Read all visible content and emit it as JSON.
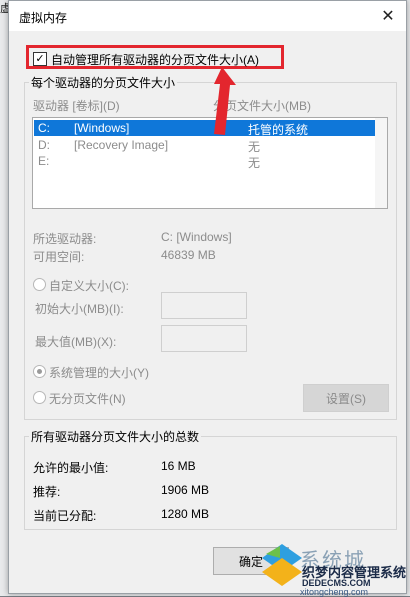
{
  "window": {
    "title": "虚拟内存",
    "close_glyph": "✕",
    "behind_char": "虚"
  },
  "auto_manage": {
    "label": "自动管理所有驱动器的分页文件大小(A)",
    "checked": true,
    "check_glyph": "✓"
  },
  "per_drive": {
    "group_title": "每个驱动器的分页文件大小",
    "col_drive": "驱动器 [卷标](D)",
    "col_size": "分页文件大小(MB)",
    "rows": [
      {
        "drive": "C:",
        "label": "[Windows]",
        "size": "托管的系统",
        "selected": true
      },
      {
        "drive": "D:",
        "label": "[Recovery Image]",
        "size": "无",
        "selected": false
      },
      {
        "drive": "E:",
        "label": "",
        "size": "无",
        "selected": false
      }
    ],
    "selected_drive_label": "所选驱动器:",
    "selected_drive_value": "C:  [Windows]",
    "free_space_label": "可用空间:",
    "free_space_value": "46839 MB",
    "custom_size_label": "自定义大小(C):",
    "initial_size_label": "初始大小(MB)(I):",
    "max_size_label": "最大值(MB)(X):",
    "system_managed_label": "系统管理的大小(Y)",
    "no_paging_label": "无分页文件(N)",
    "set_button": "设置(S)"
  },
  "totals": {
    "group_title": "所有驱动器分页文件大小的总数",
    "min_label": "允许的最小值:",
    "min_value": "16 MB",
    "recommended_label": "推荐:",
    "recommended_value": "1906 MB",
    "current_label": "当前已分配:",
    "current_value": "1280 MB"
  },
  "buttons": {
    "ok": "确定"
  },
  "watermark": {
    "brand_cn": "系统城",
    "line1": "织梦内容管理系统",
    "line2": "DEDECMS.COM",
    "line3": "xitongcheng.com"
  },
  "colors": {
    "highlight_red": "#e3262e",
    "selection_blue": "#0f77d9"
  }
}
